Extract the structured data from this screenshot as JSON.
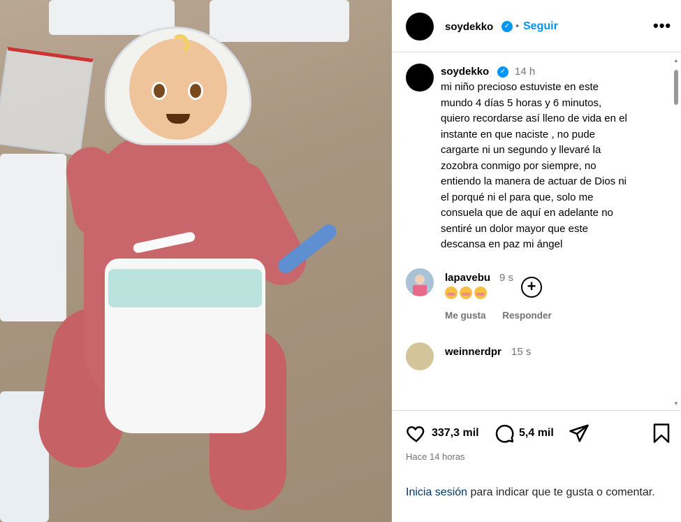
{
  "post": {
    "username": "soydekko",
    "follow_label": "Seguir",
    "separator": "•",
    "more_label": "•••"
  },
  "caption": {
    "username": "soydekko",
    "time": "14 h",
    "text": "mi niño precioso estuviste en este\nmundo 4 días 5 horas y 6 minutos,\nquiero recordarse así lleno de vida en el\ninstante en que naciste , no pude\ncargarte ni un segundo y llevaré la\nzozobra conmigo por siempre, no\nentiendo la manera de actuar de Dios ni\nel porqué ni el para que, solo me\nconsuela que de aquí en adelante no\nsentiré un dolor mayor que este\ndescansa en paz mi ángel"
  },
  "comments": [
    {
      "username": "lapavebu",
      "time": "9 s",
      "emojis": [
        "flushed-face",
        "flushed-face",
        "flushed-face"
      ],
      "like_label": "Me gusta",
      "reply_label": "Responder"
    },
    {
      "username": "weinnerdpr",
      "time": "15 s"
    }
  ],
  "actions": {
    "likes": "337,3 mil",
    "comments": "5,4 mil"
  },
  "posted_ago": "Hace 14 horas",
  "login_prompt": {
    "link": "Inicia sesión",
    "rest": " para indicar que te gusta o comentar."
  },
  "colors": {
    "accent": "#0095f6",
    "link": "#00376b",
    "muted": "#737373"
  },
  "icons": {
    "verified": "verified-badge-icon",
    "heart": "heart-icon",
    "comment": "comment-bubble-icon",
    "share": "send-icon",
    "bookmark": "bookmark-icon",
    "add": "plus-circle-icon"
  }
}
